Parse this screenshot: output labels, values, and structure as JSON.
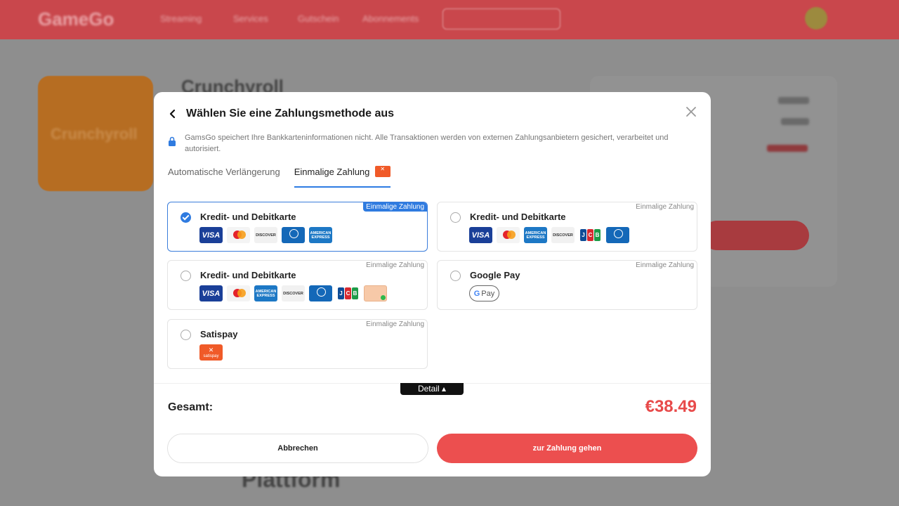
{
  "background": {
    "logo": "GameGo",
    "nav": [
      "Streaming",
      "Services",
      "Gutschein",
      "Abonnements"
    ],
    "product_title": "Crunchyroll",
    "tile_text": "Crunchyroll",
    "section_title": "Plattform"
  },
  "modal": {
    "title": "Wählen Sie eine Zahlungsmethode aus",
    "notice": "GamsGo speichert Ihre Bankkarteninformationen nicht. Alle Transaktionen werden von externen Zahlungsanbietern gesichert, verarbeitet und autorisiert.",
    "tabs": [
      {
        "label": "Automatische Verlängerung",
        "active": false
      },
      {
        "label": "Einmalige Zahlung",
        "active": true
      }
    ],
    "options": [
      {
        "label": "Kredit- und Debitkarte",
        "tag": "Einmalige Zahlung",
        "selected": true,
        "cards": [
          "visa",
          "mastercard",
          "discover",
          "diners",
          "amex"
        ]
      },
      {
        "label": "Kredit- und Debitkarte",
        "tag": "Einmalige Zahlung",
        "selected": false,
        "cards": [
          "visa",
          "mastercard",
          "amex",
          "discover",
          "jcb",
          "diners"
        ]
      },
      {
        "label": "Kredit- und Debitkarte",
        "tag": "Einmalige Zahlung",
        "selected": false,
        "cards": [
          "visa",
          "mastercard",
          "amex",
          "discover",
          "diners",
          "jcb",
          "bank-transfer"
        ]
      },
      {
        "label": "Google Pay",
        "tag": "Einmalige Zahlung",
        "selected": false,
        "cards": [
          "google-pay"
        ]
      },
      {
        "label": "Satispay",
        "tag": "Einmalige Zahlung",
        "selected": false,
        "cards": [
          "satispay"
        ]
      }
    ],
    "detail_label": "Detail",
    "total_label": "Gesamt:",
    "total_value": "€38.49",
    "cancel_label": "Abbrechen",
    "pay_label": "zur Zahlung gehen"
  },
  "colors": {
    "accent_blue": "#2f7be0",
    "price_red": "#e84a4a",
    "pay_button": "#ec4f4f",
    "header_red": "#c9474c"
  }
}
